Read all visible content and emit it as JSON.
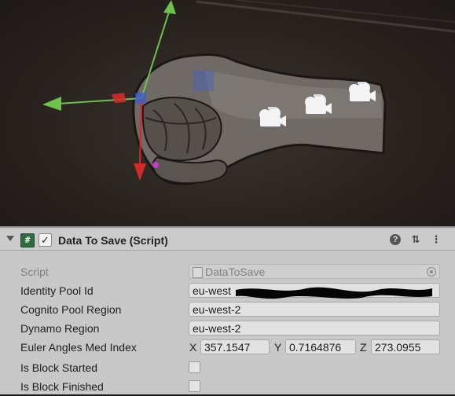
{
  "scene": {
    "icons": [
      "move-gizmo",
      "hand-model",
      "camera-icon",
      "camera-icon",
      "camera-icon"
    ]
  },
  "component": {
    "title": "Data To Save (Script)",
    "enabled": true,
    "script_badge": "#",
    "check_glyph": "✓",
    "help_glyph": "?",
    "settings_glyph": "⇅",
    "menu_glyph": "⋮"
  },
  "properties": {
    "script": {
      "label": "Script",
      "value": "DataToSave"
    },
    "identity_pool": {
      "label": "Identity Pool Id",
      "value": "eu-west"
    },
    "cognito_region": {
      "label": "Cognito Pool Region",
      "value": "eu-west-2"
    },
    "dynamo_region": {
      "label": "Dynamo Region",
      "value": "eu-west-2"
    },
    "euler": {
      "label": "Euler Angles Med Index",
      "x_label": "X",
      "x": "357.1547",
      "y_label": "Y",
      "y": "0.7164876",
      "z_label": "Z",
      "z": "273.0955"
    },
    "block_started": {
      "label": "Is Block Started",
      "checked": false
    },
    "block_finished": {
      "label": "Is Block Finished",
      "checked": false
    }
  },
  "colors": {
    "gizmo_x": "#d22a2a",
    "gizmo_y": "#6dc24b",
    "gizmo_z": "#3a5bd8",
    "inspector_bg": "#c8c8c8"
  }
}
